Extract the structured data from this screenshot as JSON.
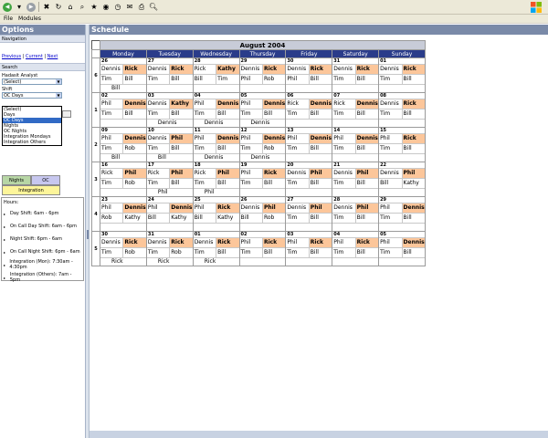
{
  "menu": {
    "file": "File",
    "modules": "Modules"
  },
  "left": {
    "title": "Options",
    "navigation_header": "Navigation",
    "links": {
      "previous": "Previous",
      "current": "Current",
      "next": "Next",
      "sep": " | "
    },
    "search_header": "Search",
    "analyst_label": "Hadasit Analyst",
    "analyst_value": "(Select)",
    "shift_label": "Shift",
    "shift_value": "OC Days",
    "shift_options": [
      "(Select)",
      "Days",
      "OC Days",
      "Nights",
      "OC Nights",
      "Integration Mondays",
      "Integration Others"
    ],
    "shift_selected_index": 2,
    "legend": [
      [
        {
          "label": "Nights",
          "color": "#b7d6a5"
        },
        {
          "label": "OC",
          "color": "#c7c7ef"
        }
      ],
      [
        {
          "label": "Integration",
          "color": "#fdf59a"
        }
      ]
    ],
    "hours_title": "Hours:",
    "hours": [
      "Day Shift: 6am - 6pm",
      "On Call Day Shift: 6am - 6pm",
      "Night Shift: 6pm - 6am",
      "On Call Night Shift: 6pm - 6am",
      "Integration (Mon): 7:30am - 4:30pm",
      "Integration (Others): 7am - 5pm"
    ]
  },
  "main": {
    "title": "Schedule",
    "month": "August 2004",
    "days": [
      "Monday",
      "Tuesday",
      "Wednesday",
      "Thursday",
      "Friday",
      "Saturday",
      "Sunday"
    ],
    "weeks": [
      {
        "label": "6",
        "cells": [
          {
            "d": "26",
            "r": [
              [
                "Dennis",
                0
              ],
              [
                "Rick",
                1
              ],
              [
                "Tim",
                0
              ],
              [
                "Bill",
                0
              ]
            ],
            "x": "Bill"
          },
          {
            "d": "27",
            "r": [
              [
                "Dennis",
                0
              ],
              [
                "Rick",
                1
              ],
              [
                "Tim",
                0
              ],
              [
                "Bill",
                0
              ]
            ],
            "x": ""
          },
          {
            "d": "28",
            "r": [
              [
                "Rick",
                0
              ],
              [
                "Kathy",
                1
              ],
              [
                "Bill",
                0
              ],
              [
                "Tim",
                0
              ]
            ],
            "x": ""
          },
          {
            "d": "29",
            "r": [
              [
                "Dennis",
                0
              ],
              [
                "Rick",
                1
              ],
              [
                "Phil",
                0
              ],
              [
                "Rob",
                0
              ]
            ],
            "x": ""
          },
          {
            "d": "30",
            "r": [
              [
                "Dennis",
                0
              ],
              [
                "Rick",
                1
              ],
              [
                "Phil",
                0
              ],
              [
                "Bill",
                0
              ]
            ],
            "x": ""
          },
          {
            "d": "31",
            "r": [
              [
                "Dennis",
                0
              ],
              [
                "Rick",
                1
              ],
              [
                "Tim",
                0
              ],
              [
                "Bill",
                0
              ]
            ],
            "x": ""
          },
          {
            "d": "01",
            "r": [
              [
                "Dennis",
                0
              ],
              [
                "Rick",
                1
              ],
              [
                "Tim",
                0
              ],
              [
                "Bill",
                0
              ]
            ],
            "x": ""
          }
        ]
      },
      {
        "label": "1",
        "cells": [
          {
            "d": "02",
            "r": [
              [
                "Phil",
                0
              ],
              [
                "Dennis",
                1
              ],
              [
                "Tim",
                0
              ],
              [
                "Bill",
                0
              ]
            ],
            "x": ""
          },
          {
            "d": "03",
            "r": [
              [
                "Dennis",
                0
              ],
              [
                "Kathy",
                1
              ],
              [
                "Tim",
                0
              ],
              [
                "Bill",
                0
              ]
            ],
            "x": "Dennis"
          },
          {
            "d": "04",
            "r": [
              [
                "Phil",
                0
              ],
              [
                "Dennis",
                1
              ],
              [
                "Tim",
                0
              ],
              [
                "Bill",
                0
              ]
            ],
            "x": "Dennis"
          },
          {
            "d": "05",
            "r": [
              [
                "Phil",
                0
              ],
              [
                "Dennis",
                1
              ],
              [
                "Tim",
                0
              ],
              [
                "Bill",
                0
              ]
            ],
            "x": "Dennis"
          },
          {
            "d": "06",
            "r": [
              [
                "Rick",
                0
              ],
              [
                "Dennis",
                1
              ],
              [
                "Tim",
                0
              ],
              [
                "Bill",
                0
              ]
            ],
            "x": ""
          },
          {
            "d": "07",
            "r": [
              [
                "Rick",
                0
              ],
              [
                "Dennis",
                1
              ],
              [
                "Tim",
                0
              ],
              [
                "Bill",
                0
              ]
            ],
            "x": ""
          },
          {
            "d": "08",
            "r": [
              [
                "Dennis",
                0
              ],
              [
                "Rick",
                1
              ],
              [
                "Tim",
                0
              ],
              [
                "Bill",
                0
              ]
            ],
            "x": ""
          }
        ]
      },
      {
        "label": "2",
        "cells": [
          {
            "d": "09",
            "r": [
              [
                "Phil",
                0
              ],
              [
                "Dennis",
                1
              ],
              [
                "Tim",
                0
              ],
              [
                "Rob",
                0
              ]
            ],
            "x": "Bill"
          },
          {
            "d": "10",
            "r": [
              [
                "Dennis",
                0
              ],
              [
                "Phil",
                1
              ],
              [
                "Tim",
                0
              ],
              [
                "Bill",
                0
              ]
            ],
            "x": "Bill"
          },
          {
            "d": "11",
            "r": [
              [
                "Phil",
                0
              ],
              [
                "Dennis",
                1
              ],
              [
                "Tim",
                0
              ],
              [
                "Bill",
                0
              ]
            ],
            "x": "Dennis"
          },
          {
            "d": "12",
            "r": [
              [
                "Phil",
                0
              ],
              [
                "Dennis",
                1
              ],
              [
                "Tim",
                0
              ],
              [
                "Rob",
                0
              ]
            ],
            "x": "Dennis"
          },
          {
            "d": "13",
            "r": [
              [
                "Phil",
                0
              ],
              [
                "Dennis",
                1
              ],
              [
                "Tim",
                0
              ],
              [
                "Bill",
                0
              ]
            ],
            "x": ""
          },
          {
            "d": "14",
            "r": [
              [
                "Phil",
                0
              ],
              [
                "Dennis",
                1
              ],
              [
                "Tim",
                0
              ],
              [
                "Bill",
                0
              ]
            ],
            "x": ""
          },
          {
            "d": "15",
            "r": [
              [
                "Phil",
                0
              ],
              [
                "Rick",
                1
              ],
              [
                "Tim",
                0
              ],
              [
                "Bill",
                0
              ]
            ],
            "x": ""
          }
        ]
      },
      {
        "label": "3",
        "cells": [
          {
            "d": "16",
            "r": [
              [
                "Rick",
                0
              ],
              [
                "Phil",
                1
              ],
              [
                "Tim",
                0
              ],
              [
                "Rob",
                0
              ]
            ],
            "x": ""
          },
          {
            "d": "17",
            "r": [
              [
                "Rick",
                0
              ],
              [
                "Phil",
                1
              ],
              [
                "Tim",
                0
              ],
              [
                "Bill",
                0
              ]
            ],
            "x": "Phil"
          },
          {
            "d": "18",
            "r": [
              [
                "Rick",
                0
              ],
              [
                "Phil",
                1
              ],
              [
                "Tim",
                0
              ],
              [
                "Bill",
                0
              ]
            ],
            "x": "Phil"
          },
          {
            "d": "19",
            "r": [
              [
                "Phil",
                0
              ],
              [
                "Rick",
                1
              ],
              [
                "Tim",
                0
              ],
              [
                "Bill",
                0
              ]
            ],
            "x": ""
          },
          {
            "d": "20",
            "r": [
              [
                "Dennis",
                0
              ],
              [
                "Phil",
                1
              ],
              [
                "Tim",
                0
              ],
              [
                "Bill",
                0
              ]
            ],
            "x": ""
          },
          {
            "d": "21",
            "r": [
              [
                "Dennis",
                0
              ],
              [
                "Phil",
                1
              ],
              [
                "Tim",
                0
              ],
              [
                "Bill",
                0
              ]
            ],
            "x": ""
          },
          {
            "d": "22",
            "r": [
              [
                "Dennis",
                0
              ],
              [
                "Phil",
                1
              ],
              [
                "Bill",
                0
              ],
              [
                "Kathy",
                0
              ]
            ],
            "x": ""
          }
        ]
      },
      {
        "label": "4",
        "cells": [
          {
            "d": "23",
            "r": [
              [
                "Phil",
                0
              ],
              [
                "Dennis",
                1
              ],
              [
                "Rob",
                0
              ],
              [
                "Kathy",
                0
              ]
            ],
            "x": ""
          },
          {
            "d": "24",
            "r": [
              [
                "Phil",
                0
              ],
              [
                "Dennis",
                1
              ],
              [
                "Bill",
                0
              ],
              [
                "Kathy",
                0
              ]
            ],
            "x": ""
          },
          {
            "d": "25",
            "r": [
              [
                "Phil",
                0
              ],
              [
                "Rick",
                1
              ],
              [
                "Bill",
                0
              ],
              [
                "Kathy",
                0
              ]
            ],
            "x": ""
          },
          {
            "d": "26",
            "r": [
              [
                "Dennis",
                0
              ],
              [
                "Phil",
                1
              ],
              [
                "Bill",
                0
              ],
              [
                "Rob",
                0
              ]
            ],
            "x": ""
          },
          {
            "d": "27",
            "r": [
              [
                "Dennis",
                0
              ],
              [
                "Phil",
                1
              ],
              [
                "Tim",
                0
              ],
              [
                "Bill",
                0
              ]
            ],
            "x": ""
          },
          {
            "d": "28",
            "r": [
              [
                "Dennis",
                0
              ],
              [
                "Phil",
                1
              ],
              [
                "Tim",
                0
              ],
              [
                "Bill",
                0
              ]
            ],
            "x": ""
          },
          {
            "d": "29",
            "r": [
              [
                "Phil",
                0
              ],
              [
                "Dennis",
                1
              ],
              [
                "Tim",
                0
              ],
              [
                "Bill",
                0
              ]
            ],
            "x": ""
          }
        ]
      },
      {
        "label": "5",
        "cells": [
          {
            "d": "30",
            "r": [
              [
                "Dennis",
                0
              ],
              [
                "Rick",
                1
              ],
              [
                "Tim",
                0
              ],
              [
                "Rob",
                0
              ]
            ],
            "x": "Rick"
          },
          {
            "d": "31",
            "r": [
              [
                "Dennis",
                0
              ],
              [
                "Rick",
                1
              ],
              [
                "Tim",
                0
              ],
              [
                "Rob",
                0
              ]
            ],
            "x": "Rick"
          },
          {
            "d": "01",
            "r": [
              [
                "Dennis",
                0
              ],
              [
                "Rick",
                1
              ],
              [
                "Tim",
                0
              ],
              [
                "Bill",
                0
              ]
            ],
            "x": "Rick"
          },
          {
            "d": "02",
            "r": [
              [
                "Phil",
                0
              ],
              [
                "Rick",
                1
              ],
              [
                "Tim",
                0
              ],
              [
                "Bill",
                0
              ]
            ],
            "x": ""
          },
          {
            "d": "03",
            "r": [
              [
                "Phil",
                0
              ],
              [
                "Rick",
                1
              ],
              [
                "Tim",
                0
              ],
              [
                "Bill",
                0
              ]
            ],
            "x": ""
          },
          {
            "d": "04",
            "r": [
              [
                "Phil",
                0
              ],
              [
                "Rick",
                1
              ],
              [
                "Tim",
                0
              ],
              [
                "Bill",
                0
              ]
            ],
            "x": ""
          },
          {
            "d": "05",
            "r": [
              [
                "Phil",
                0
              ],
              [
                "Dennis",
                1
              ],
              [
                "Tim",
                0
              ],
              [
                "Bill",
                0
              ]
            ],
            "x": ""
          }
        ]
      }
    ]
  }
}
